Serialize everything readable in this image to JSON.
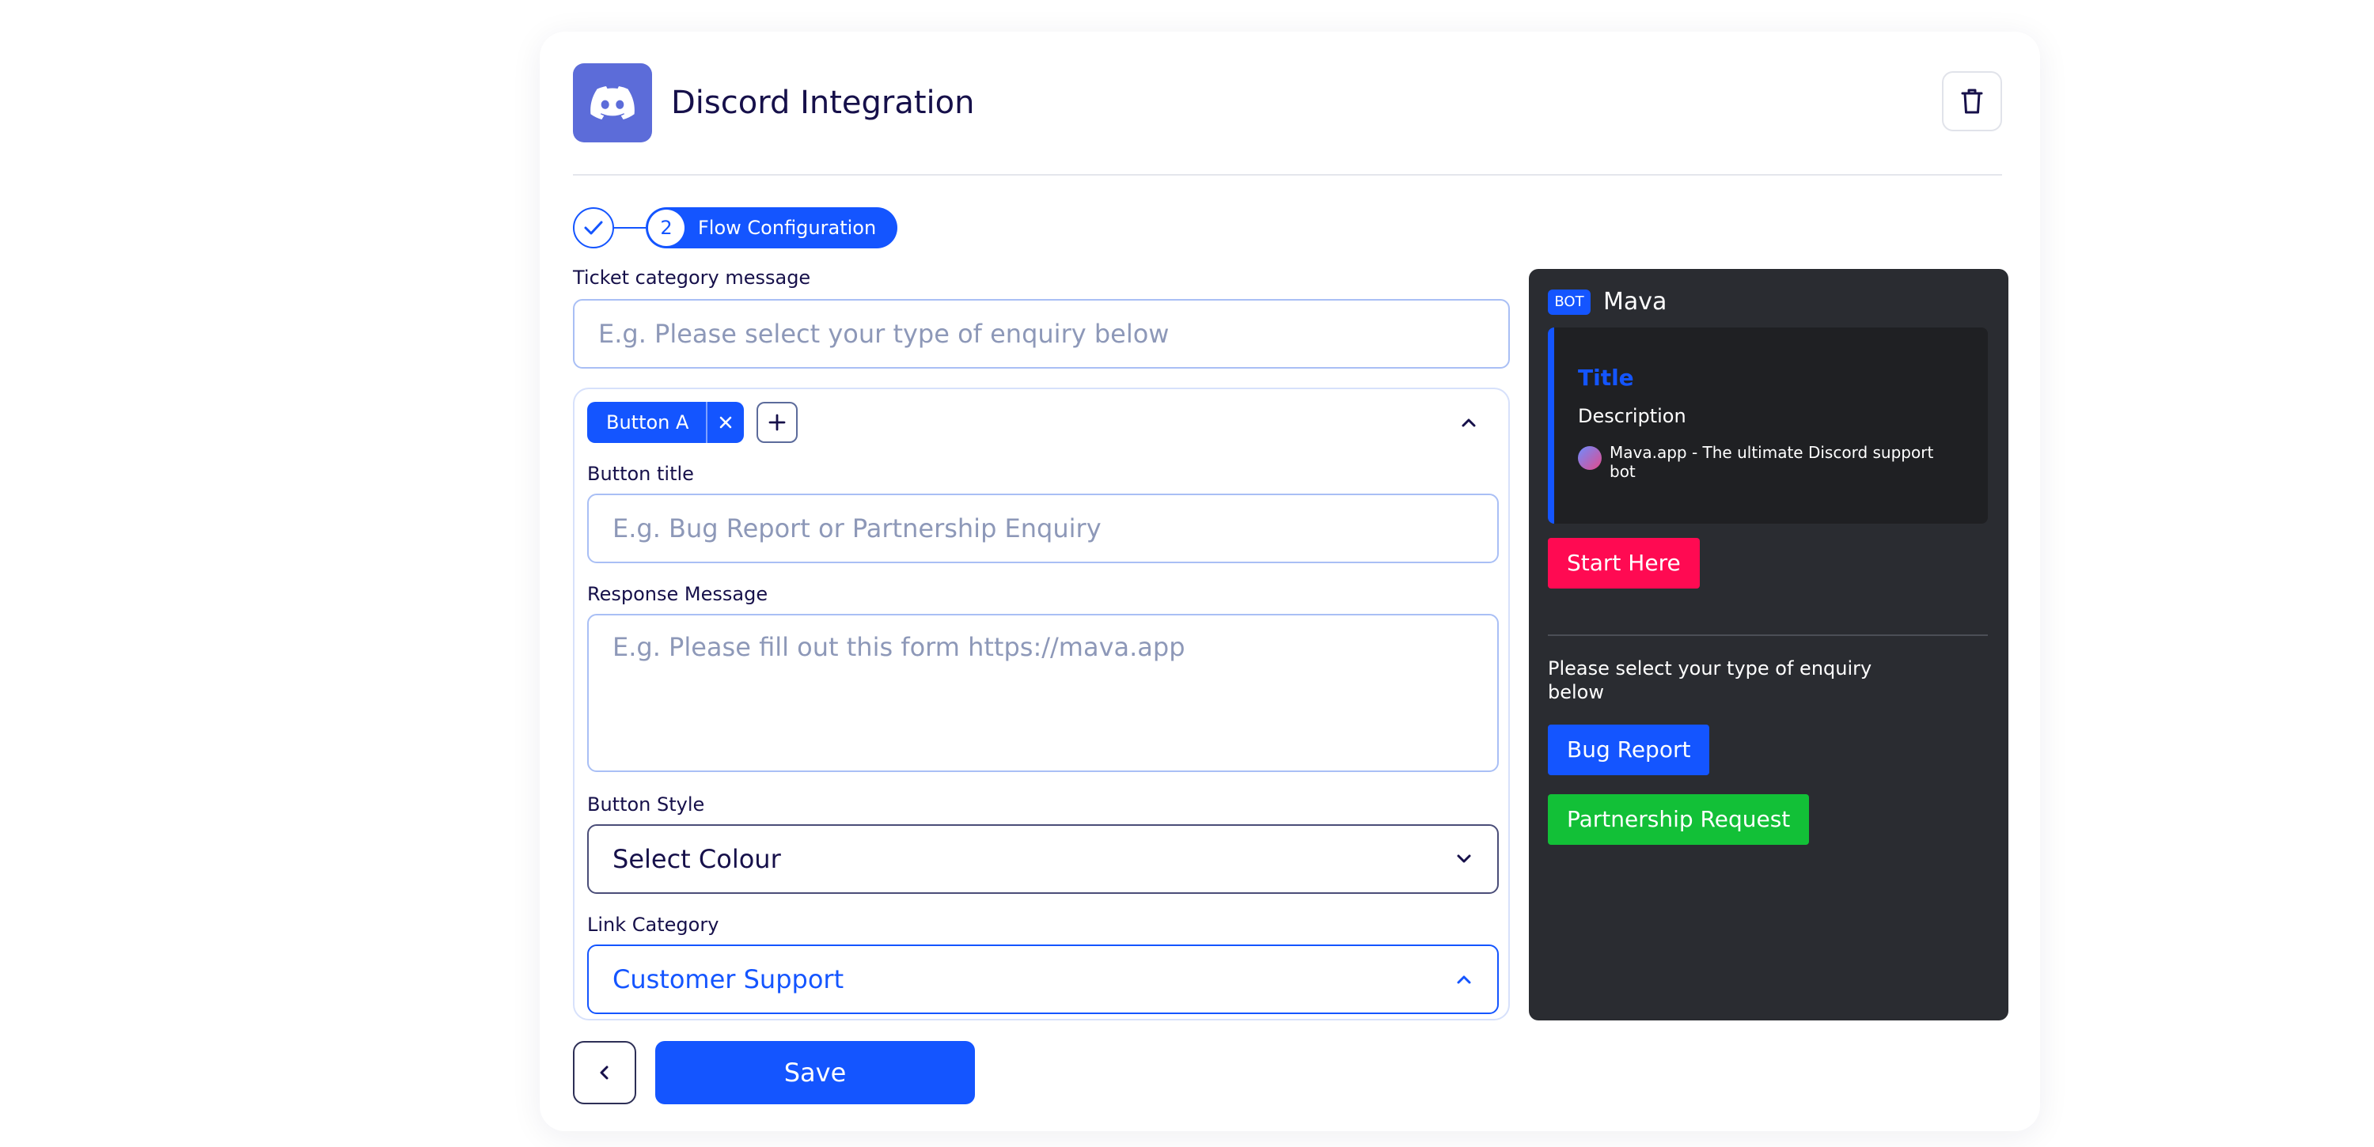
{
  "header": {
    "title": "Discord Integration",
    "logo_icon": "discord-icon",
    "delete_icon": "trash-icon"
  },
  "steps": {
    "step1_icon": "check-icon",
    "step2_number": "2",
    "step2_label": "Flow Configuration"
  },
  "ticket_category": {
    "label": "Ticket category message",
    "placeholder": "E.g. Please select your type of enquiry below"
  },
  "button_editor": {
    "tab_label": "Button A",
    "remove_icon": "close-icon",
    "add_icon": "plus-icon",
    "collapse_icon": "chevron-up-icon",
    "button_title": {
      "label": "Button title",
      "placeholder": "E.g. Bug Report or Partnership Enquiry"
    },
    "response_message": {
      "label": "Response Message",
      "placeholder": "E.g. Please fill out this form https://mava.app"
    },
    "button_style": {
      "label": "Button Style",
      "value": "Select Colour"
    },
    "link_category": {
      "label": "Link Category",
      "value": "Customer Support"
    }
  },
  "actions": {
    "back_icon": "chevron-left-icon",
    "save_label": "Save"
  },
  "preview": {
    "bot_badge": "BOT",
    "bot_name": "Mava",
    "embed": {
      "title": "Title",
      "description": "Description",
      "footer": "Mava.app - The ultimate Discord support bot"
    },
    "start_button": "Start Here",
    "message": "Please select your type of enquiry below",
    "buttons": [
      "Bug Report",
      "Partnership Request"
    ]
  },
  "colors": {
    "primary": "#1455ff",
    "discord": "#5c6cd9",
    "preview_bg": "#2a2c31",
    "start_button": "#ff0a52",
    "success_button": "#12c037"
  }
}
